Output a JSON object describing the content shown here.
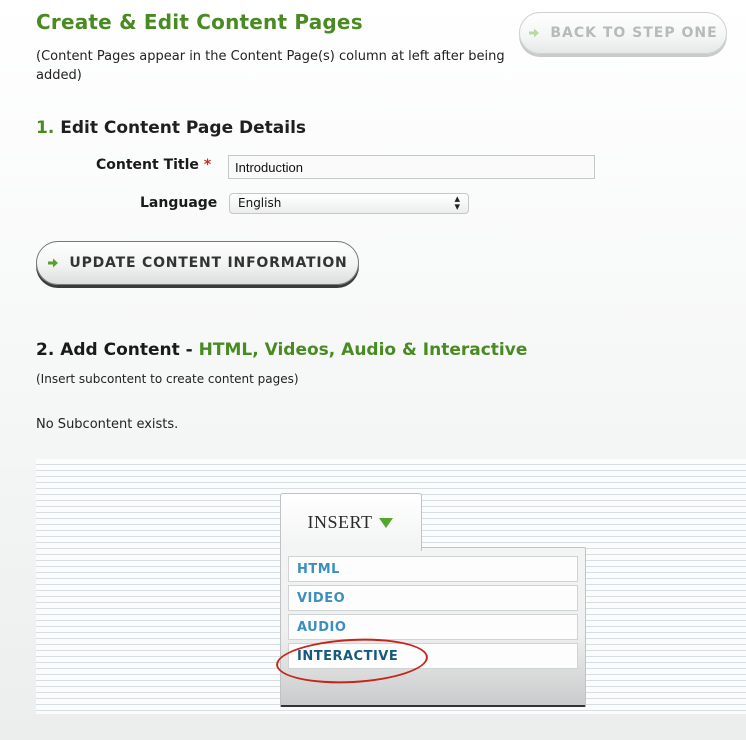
{
  "header": {
    "title": "Create & Edit Content Pages",
    "subtitle": "(Content Pages appear in the Content Page(s) column at left after being added)",
    "back_button_label": "BACK TO STEP ONE"
  },
  "section1": {
    "number": "1.",
    "heading": "Edit Content Page Details",
    "content_title_label": "Content Title",
    "required_marker": "*",
    "content_title_value": "Introduction",
    "language_label": "Language",
    "language_selected": "English",
    "update_button_label": "UPDATE CONTENT INFORMATION"
  },
  "section2": {
    "heading_prefix": "2. Add Content - ",
    "heading_highlight": "HTML, Videos, Audio & Interactive",
    "subtext": "(Insert subcontent to create content pages)",
    "empty_message": "No Subcontent exists."
  },
  "insert_menu": {
    "tab_label": "INSERT",
    "items": [
      "HTML",
      "VIDEO",
      "AUDIO",
      "INTERACTIVE"
    ]
  },
  "colors": {
    "accent_green": "#4a8a22",
    "link_blue": "#3b8fbf",
    "required_red": "#d0261f",
    "annotation_red": "#c8241b"
  },
  "icons": {
    "back_button": "arrow-right-icon",
    "update_button": "arrow-right-icon",
    "insert_tab": "triangle-down-icon",
    "language_select": "select-caret-icon"
  }
}
